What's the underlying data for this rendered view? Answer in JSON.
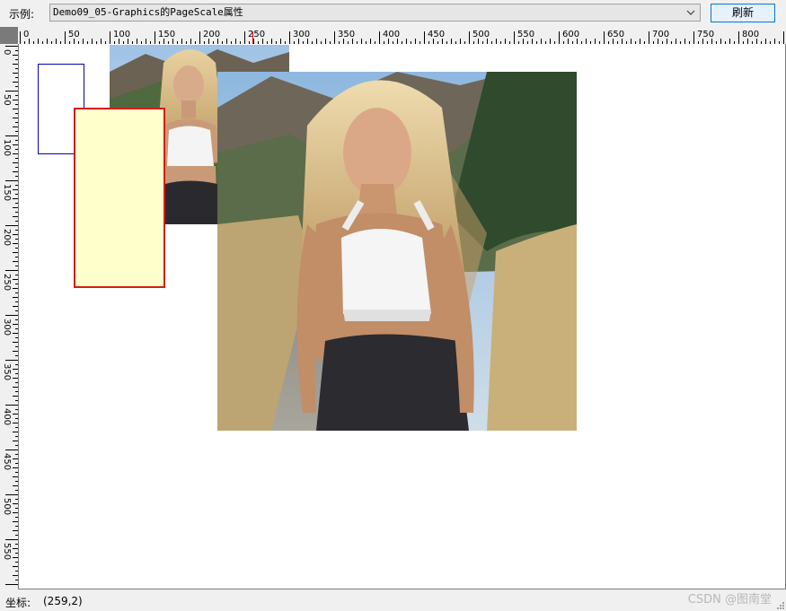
{
  "toolbar": {
    "example_label": "示例:",
    "example_value": "Demo09_05-Graphics的PageScale属性",
    "refresh_label": "刷新"
  },
  "ruler_top": [
    "0",
    "50",
    "100",
    "150",
    "200",
    "250",
    "300",
    "350",
    "400",
    "450",
    "500",
    "550",
    "600",
    "650",
    "700",
    "750",
    "800"
  ],
  "ruler_left": [
    "0",
    "50",
    "100",
    "150",
    "200",
    "250",
    "300",
    "350",
    "400",
    "450",
    "500",
    "550"
  ],
  "status": {
    "coord_label": "坐标:",
    "coord_value": "(259,2)"
  },
  "watermark": "CSDN @图南堂",
  "colors": {
    "blue_rect": "#0000c0",
    "red_rect": "#d41e10",
    "yellow_fill": "#ffffcc",
    "ruler_marker": "#ff0000"
  },
  "canvas_items": [
    "blue-outline-rectangle",
    "yellow-filled-rectangle-red-border",
    "photo-small",
    "photo-large"
  ]
}
